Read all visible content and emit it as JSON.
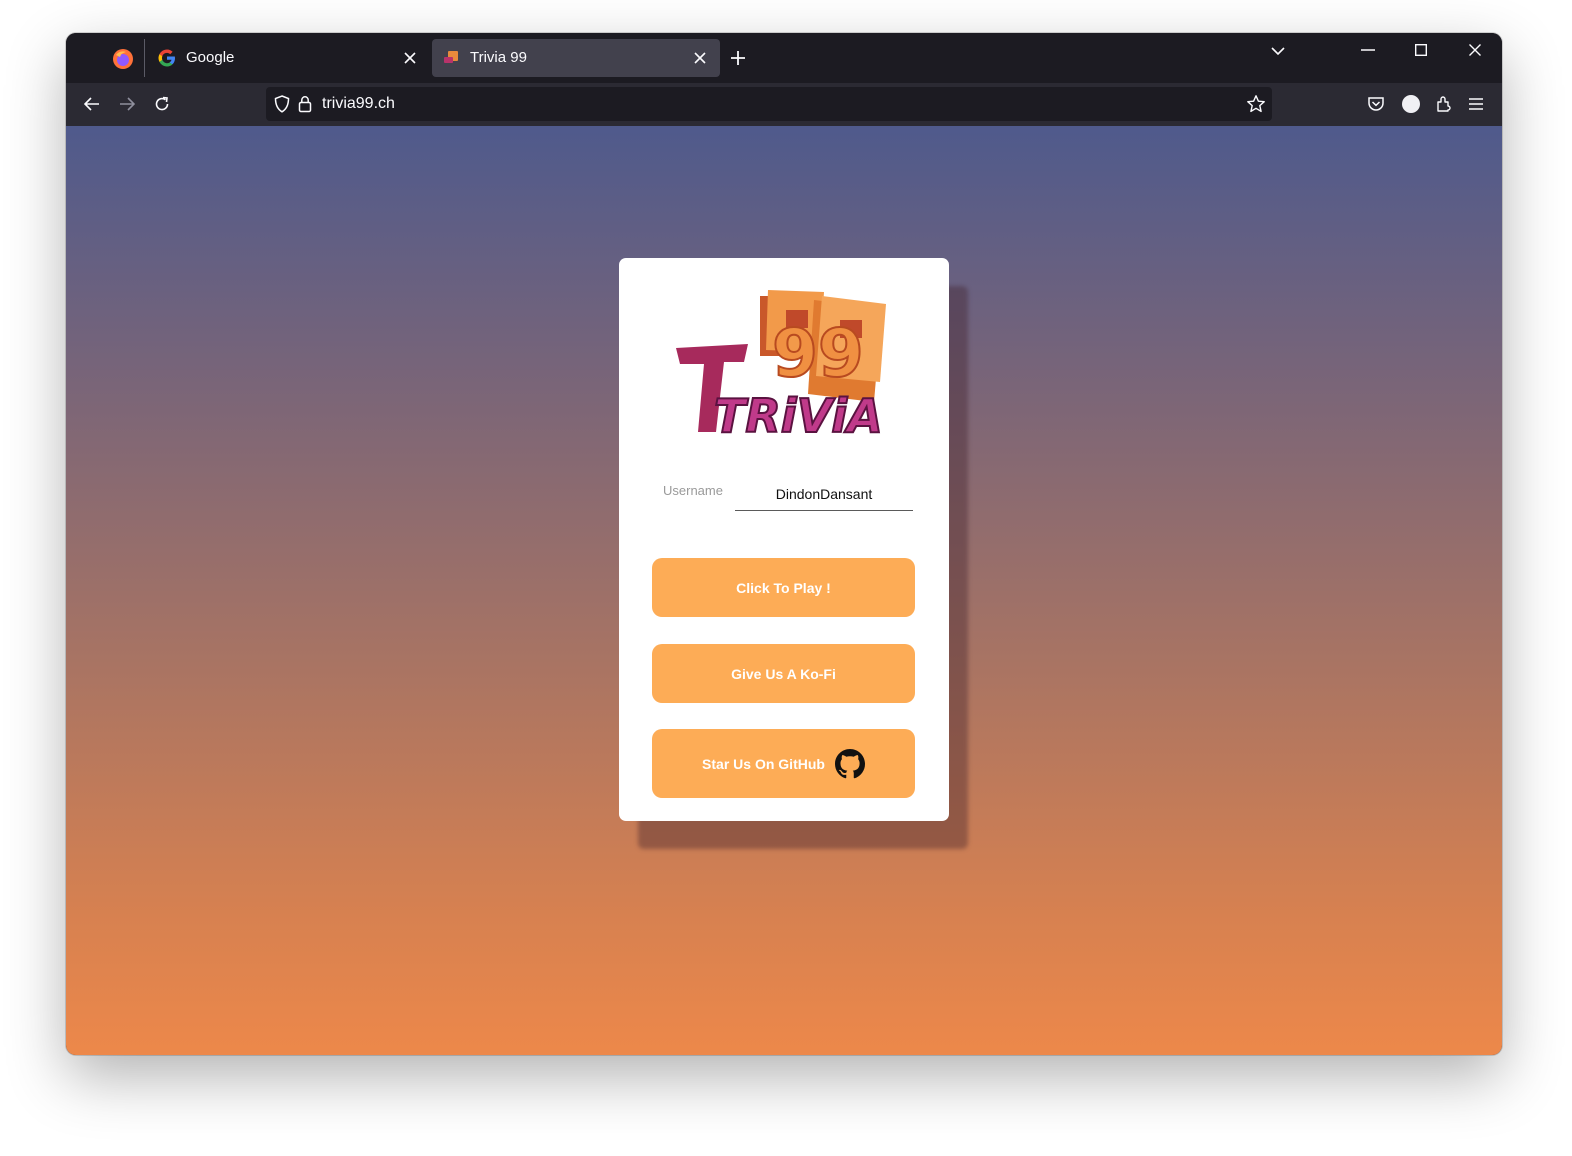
{
  "browser": {
    "tabs": [
      {
        "title": "Google",
        "active": false,
        "favicon": "google-g-icon"
      },
      {
        "title": "Trivia 99",
        "active": true,
        "favicon": "trivia99-icon"
      }
    ],
    "url": "trivia99.ch"
  },
  "page": {
    "logo": {
      "numerals": "99",
      "word": "TRiViA"
    },
    "username": {
      "label": "Username",
      "value": "DindonDansant"
    },
    "buttons": {
      "play": "Click To Play !",
      "kofi": "Give Us A Ko-Fi",
      "github": "Star Us On GitHub"
    },
    "colors": {
      "button": "#fdac56",
      "gradient_top": "#4f5a8c",
      "gradient_bottom": "#ed884a"
    }
  }
}
